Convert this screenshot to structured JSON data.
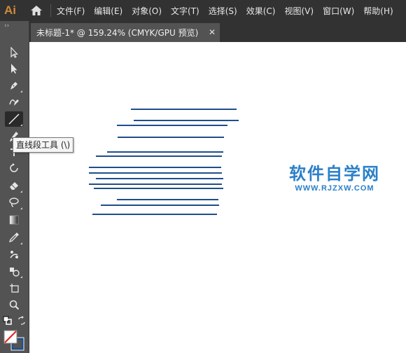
{
  "app": {
    "logo": "Ai",
    "menu": [
      "文件(F)",
      "编辑(E)",
      "对象(O)",
      "文字(T)",
      "选择(S)",
      "效果(C)",
      "视图(V)",
      "窗口(W)",
      "帮助(H)"
    ]
  },
  "document_tab": {
    "title": "未标题-1* @ 159.24% (CMYK/GPU 预览)",
    "close_glyph": "✕"
  },
  "toolbar": {
    "grip": "››",
    "tools": [
      {
        "name": "selection-tool-icon"
      },
      {
        "name": "direct-selection-tool-icon"
      },
      {
        "name": "pen-tool-icon"
      },
      {
        "name": "curvature-tool-icon"
      },
      {
        "name": "line-segment-tool-icon",
        "active": true
      },
      {
        "name": "paintbrush-tool-icon"
      },
      {
        "name": "type-tool-icon"
      },
      {
        "name": "rotate-tool-icon"
      },
      {
        "name": "eraser-tool-icon"
      },
      {
        "name": "lasso-tool-icon"
      },
      {
        "name": "gradient-tool-icon"
      },
      {
        "name": "eyedropper-tool-icon"
      },
      {
        "name": "puppet-warp-tool-icon"
      },
      {
        "name": "shape-builder-tool-icon"
      },
      {
        "name": "artboard-tool-icon"
      },
      {
        "name": "zoom-tool-icon"
      }
    ]
  },
  "tooltip": {
    "text": "直线段工具 (\\)"
  },
  "canvas": {
    "line_color": "#1f4e8c"
  },
  "watermark": {
    "cn": "软件自学网",
    "en": "WWW.RJZXW.COM",
    "color": "#2a7fc8"
  }
}
